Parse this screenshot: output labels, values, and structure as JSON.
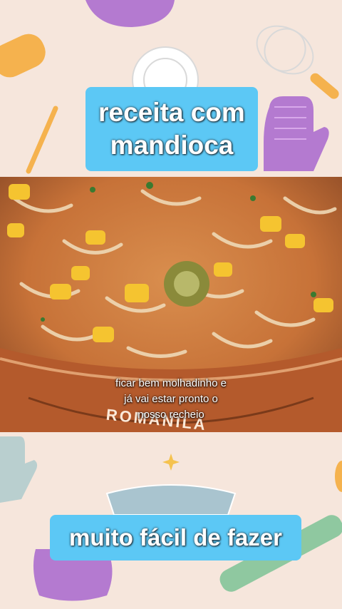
{
  "header_banner": {
    "line1": "receita com",
    "line2": "mandioca"
  },
  "video_caption": {
    "line1": "ficar bem molhadinho e",
    "line2": "já vai estar pronto o",
    "line3": "nosso recheio"
  },
  "pan_brand": "ROMANILA",
  "footer_banner": {
    "text": "muito fácil de fazer"
  },
  "colors": {
    "background": "#f6e6dc",
    "banner": "#5cc8f5",
    "accent_purple": "#b47ad0",
    "accent_orange": "#f5b24e",
    "accent_green": "#8fc8a0"
  },
  "decorative_icons": [
    "spatula-icon",
    "whisk-icon",
    "oven-mitt-icon",
    "plate-icon",
    "pie-tin-icon",
    "rolling-pin-icon",
    "sparkle-icon",
    "kettle-icon"
  ]
}
